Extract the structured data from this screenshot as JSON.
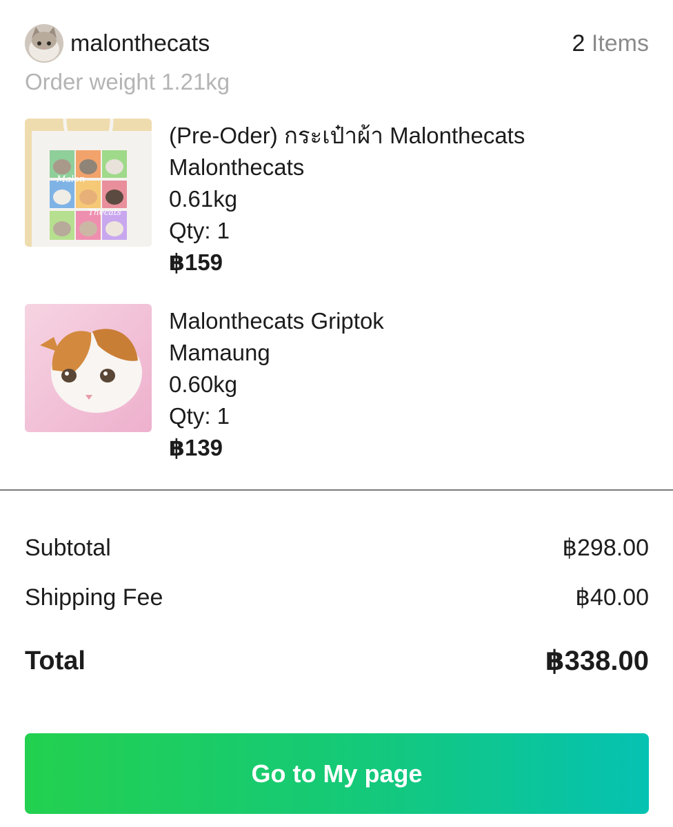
{
  "shop": {
    "name": "malonthecats",
    "item_count": "2",
    "item_count_label": "Items",
    "order_weight": "Order weight 1.21kg"
  },
  "products": [
    {
      "title": "(Pre-Oder) กระเป๋าผ้า Malonthecats",
      "variant": "Malonthecats",
      "weight": "0.61kg",
      "qty": "Qty: 1",
      "price": "฿159",
      "thumb_text_top": "Malon",
      "thumb_text_bottom": "Thecats"
    },
    {
      "title": "Malonthecats Griptok",
      "variant": "Mamaung",
      "weight": "0.60kg",
      "qty": "Qty: 1",
      "price": "฿139"
    }
  ],
  "summary": {
    "subtotal_label": "Subtotal",
    "subtotal_value": "฿298.00",
    "shipping_label": "Shipping Fee",
    "shipping_value": "฿40.00",
    "total_label": "Total",
    "total_value": "฿338.00"
  },
  "cta": {
    "label": "Go to My page"
  },
  "colors": {
    "cta_gradient_start": "#23d04f",
    "cta_gradient_end": "#05c2b2",
    "muted_text": "#b4b4b4",
    "divider": "#7a7a7a"
  }
}
